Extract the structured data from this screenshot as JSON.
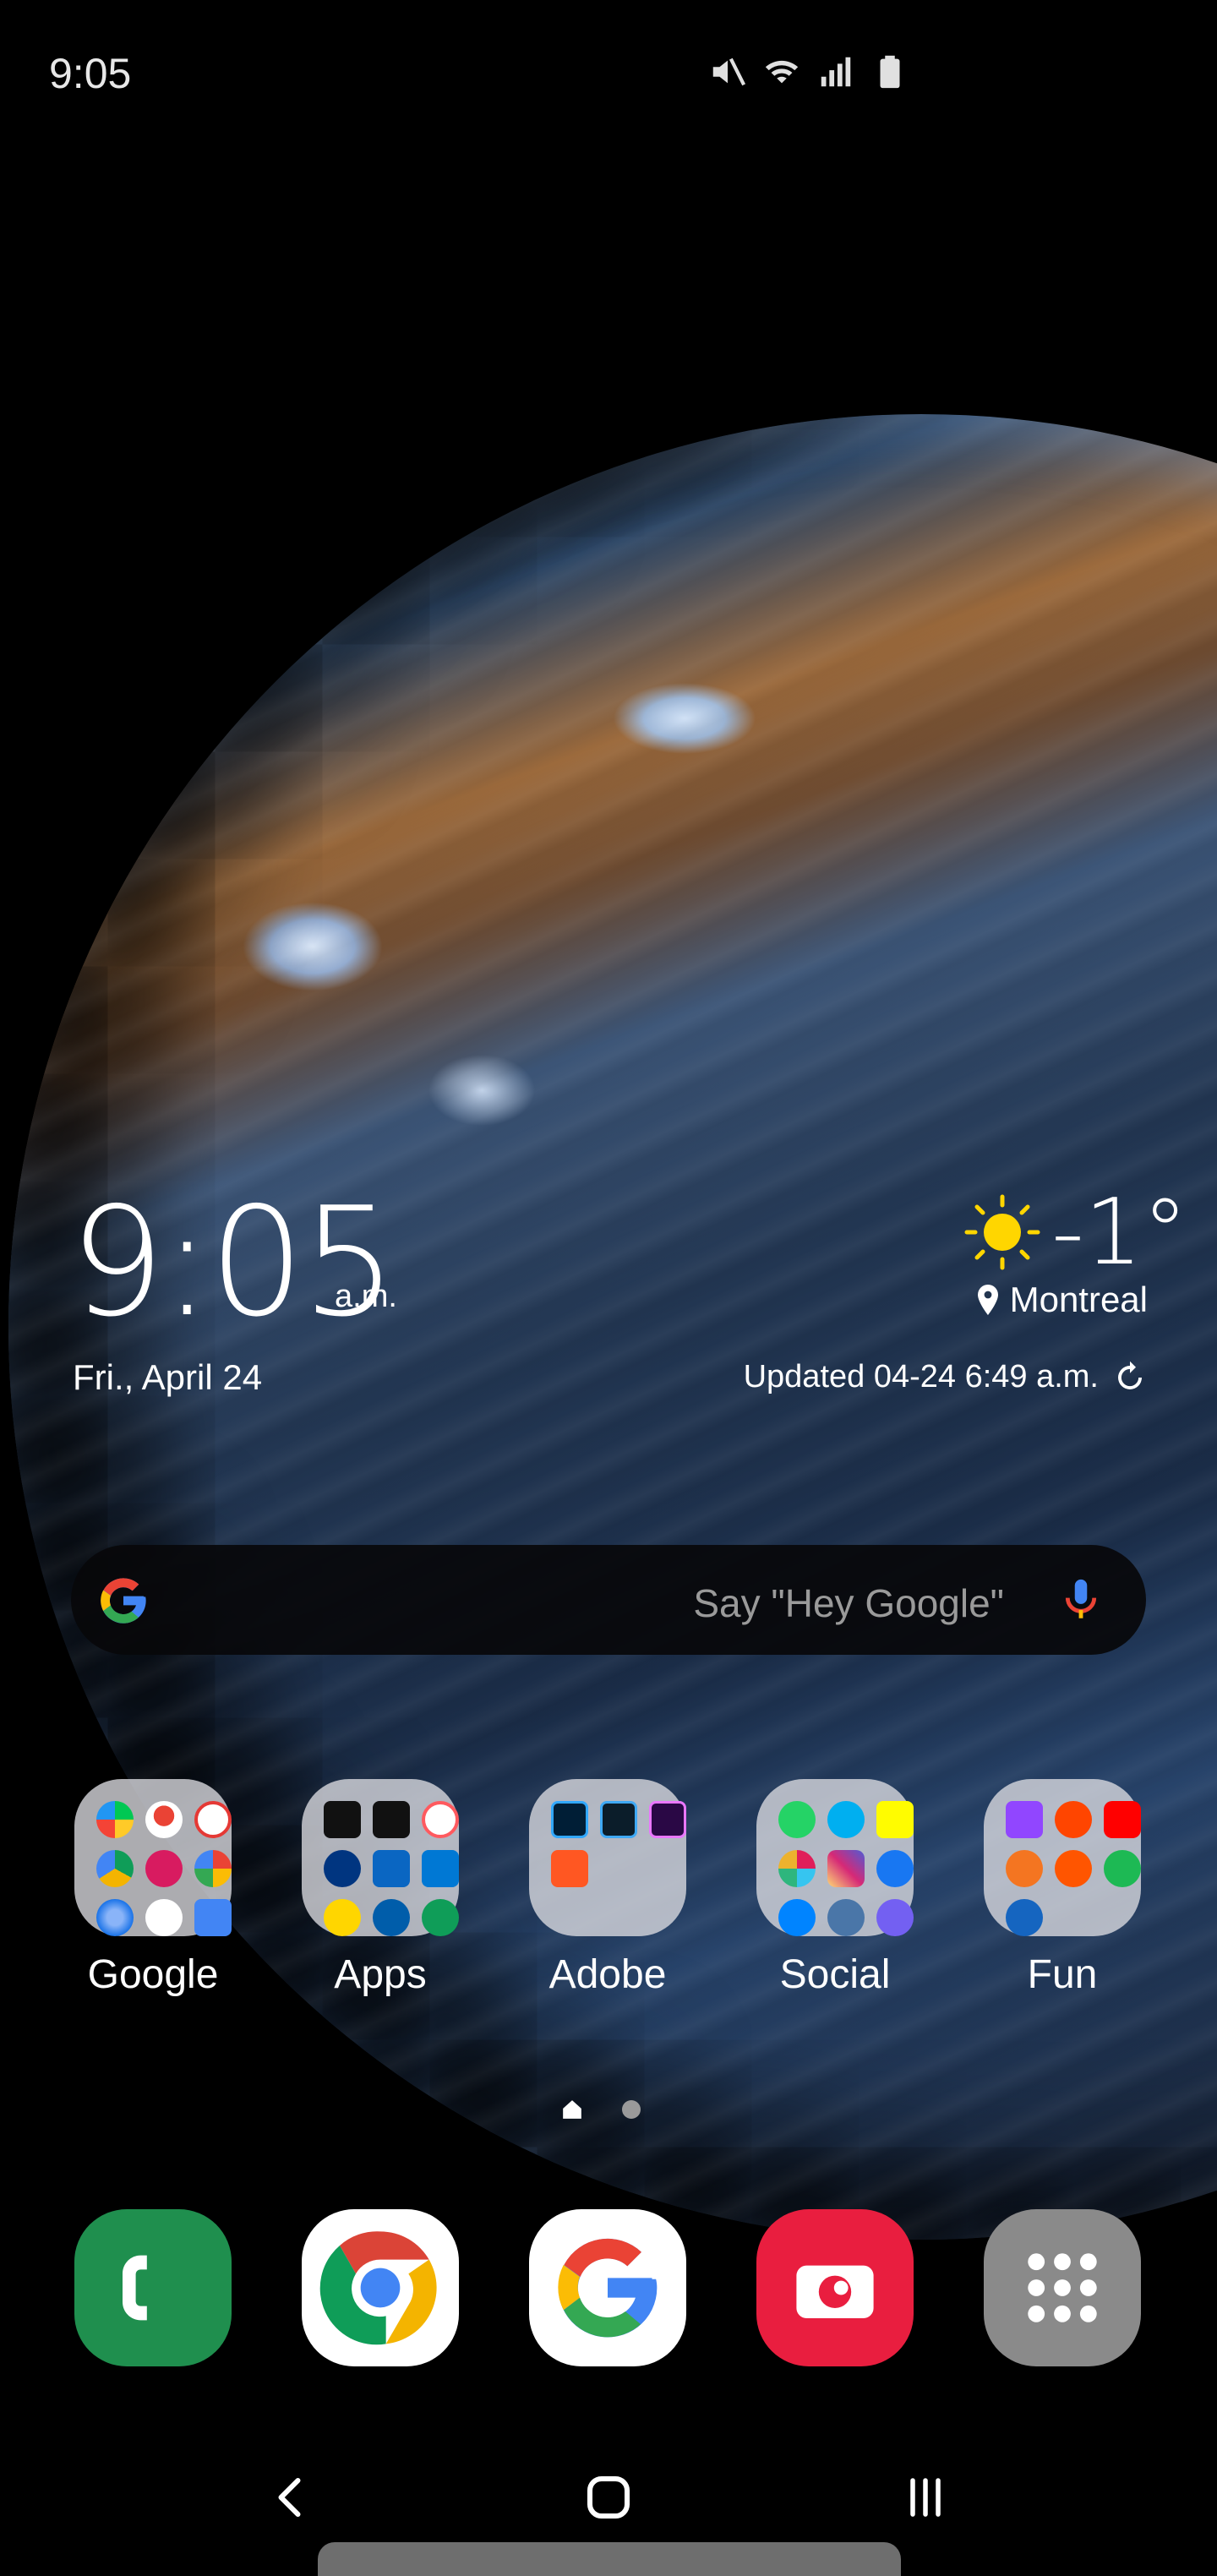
{
  "status_bar": {
    "time": "9:05",
    "icons": [
      "mute-icon",
      "wifi-icon",
      "signal-icon",
      "battery-icon"
    ]
  },
  "clock_widget": {
    "time": "9:05",
    "ampm": "a.m.",
    "date": "Fri., April 24"
  },
  "weather_widget": {
    "icon": "sun-icon",
    "temperature": "-1°",
    "location": "Montreal",
    "updated": "Updated 04-24 6:49 a.m."
  },
  "search": {
    "placeholder": "Say \"Hey Google\""
  },
  "folders": [
    {
      "label": "Google",
      "apps": [
        "Play Store",
        "Maps",
        "Calendar",
        "Drive",
        "Play Movies",
        "Photos",
        "Earth",
        "G Pay",
        "Calendar 31"
      ]
    },
    {
      "label": "Apps",
      "apps": [
        "Uber Eats",
        "Uber",
        "Airbnb",
        "Booking",
        "LinkedIn",
        "Outlook",
        "Home",
        "RBC",
        "Hexagon"
      ]
    },
    {
      "label": "Adobe",
      "apps": [
        "Lightroom",
        "Camera",
        "Rush",
        "Spark"
      ]
    },
    {
      "label": "Social",
      "apps": [
        "WhatsApp",
        "Skype",
        "Snapchat",
        "Slack",
        "Instagram",
        "Facebook",
        "Messenger",
        "VK",
        "Viber"
      ]
    },
    {
      "label": "Fun",
      "apps": [
        "Twitch",
        "Reddit",
        "YouTube",
        "Crunchyroll",
        "SoundCloud",
        "Spotify",
        "Lightning"
      ]
    }
  ],
  "dock": [
    "phone",
    "chrome",
    "google",
    "camera",
    "app-drawer"
  ],
  "colors": {
    "phone": "#1f8f4e",
    "camera": "#e91e3f",
    "drawer": "#8a8a8a",
    "chrome_red": "#db4437",
    "chrome_yellow": "#f4b400",
    "chrome_green": "#0f9d58",
    "chrome_blue": "#4285f4",
    "sun": "#ffd600"
  }
}
